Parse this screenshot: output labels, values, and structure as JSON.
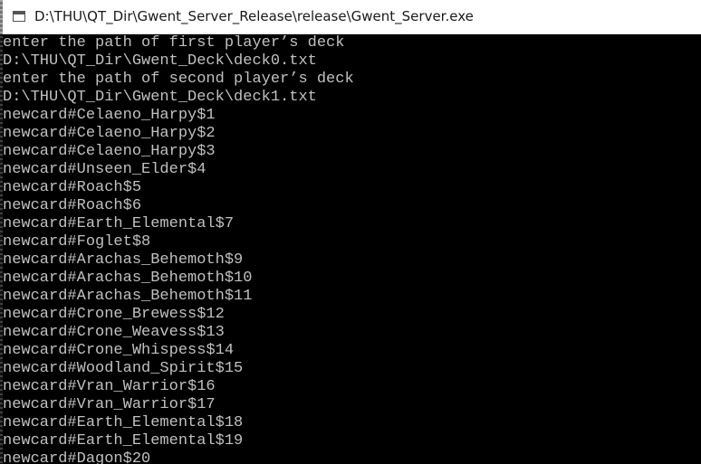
{
  "window": {
    "title": "D:\\THU\\QT_Dir\\Gwent_Server_Release\\release\\Gwent_Server.exe",
    "icon": "console-window-icon"
  },
  "console": {
    "lines": [
      "enter the path of first player’s deck",
      "D:\\THU\\QT_Dir\\Gwent_Deck\\deck0.txt",
      "enter the path of second player’s deck",
      "D:\\THU\\QT_Dir\\Gwent_Deck\\deck1.txt",
      "newcard#Celaeno_Harpy$1",
      "newcard#Celaeno_Harpy$2",
      "newcard#Celaeno_Harpy$3",
      "newcard#Unseen_Elder$4",
      "newcard#Roach$5",
      "newcard#Roach$6",
      "newcard#Earth_Elemental$7",
      "newcard#Foglet$8",
      "newcard#Arachas_Behemoth$9",
      "newcard#Arachas_Behemoth$10",
      "newcard#Arachas_Behemoth$11",
      "newcard#Crone_Brewess$12",
      "newcard#Crone_Weavess$13",
      "newcard#Crone_Whispess$14",
      "newcard#Woodland_Spirit$15",
      "newcard#Vran_Warrior$16",
      "newcard#Vran_Warrior$17",
      "newcard#Earth_Elemental$18",
      "newcard#Earth_Elemental$19",
      "newcard#Dagon$20"
    ]
  }
}
